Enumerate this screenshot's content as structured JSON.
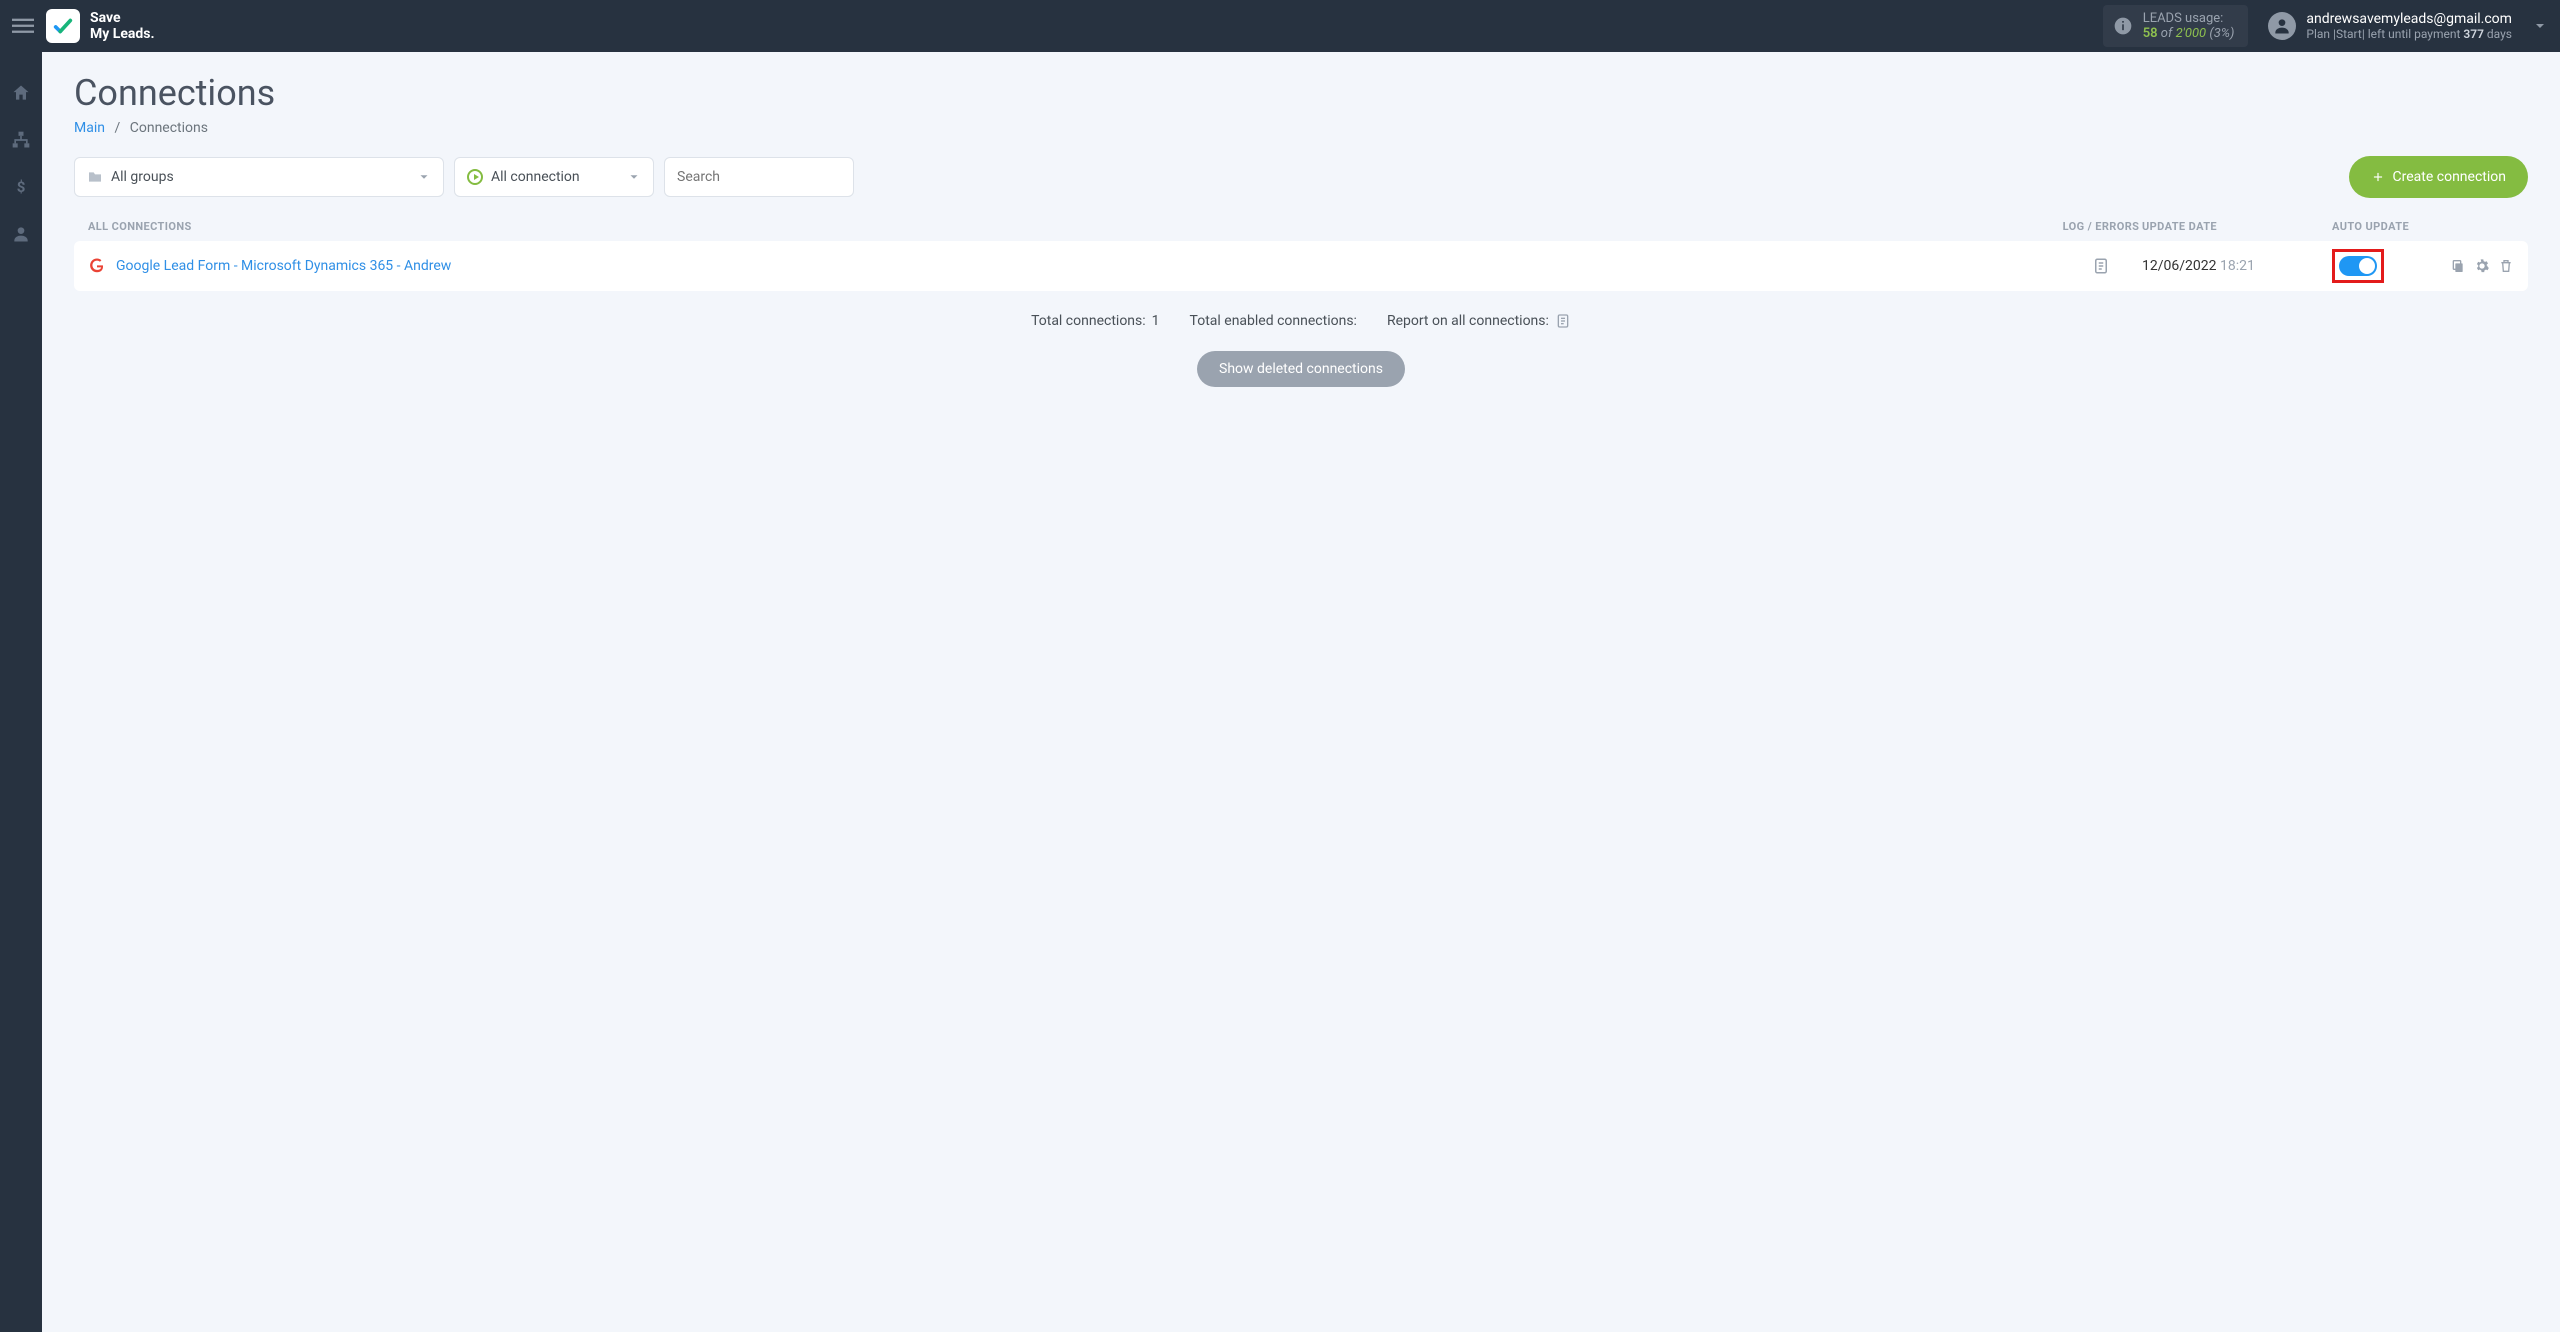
{
  "brand": {
    "line1": "Save",
    "line2": "My Leads."
  },
  "usage": {
    "label": "LEADS usage:",
    "used": "58",
    "of": "of",
    "total": "2'000",
    "pct": "(3%)"
  },
  "account": {
    "email": "andrewsavemyleads@gmail.com",
    "plan_prefix": "Plan |",
    "plan_name": "Start",
    "plan_mid": "| left until payment ",
    "plan_days": "377",
    "plan_suffix": " days"
  },
  "page": {
    "title": "Connections"
  },
  "breadcrumb": {
    "main": "Main",
    "sep": "/",
    "current": "Connections"
  },
  "filters": {
    "groups_label": "All groups",
    "status_label": "All connection",
    "search_placeholder": "Search"
  },
  "create_btn": "Create connection",
  "headers": {
    "name": "ALL CONNECTIONS",
    "log": "LOG / ERRORS",
    "date": "UPDATE DATE",
    "auto": "AUTO UPDATE"
  },
  "rows": [
    {
      "name": "Google Lead Form - Microsoft Dynamics 365 - Andrew",
      "date": "12/06/2022",
      "time": "18:21"
    }
  ],
  "summary": {
    "total_label": "Total connections:",
    "total_value": "1",
    "enabled_label": "Total enabled connections:",
    "report_label": "Report on all connections:"
  },
  "deleted_btn": "Show deleted connections"
}
